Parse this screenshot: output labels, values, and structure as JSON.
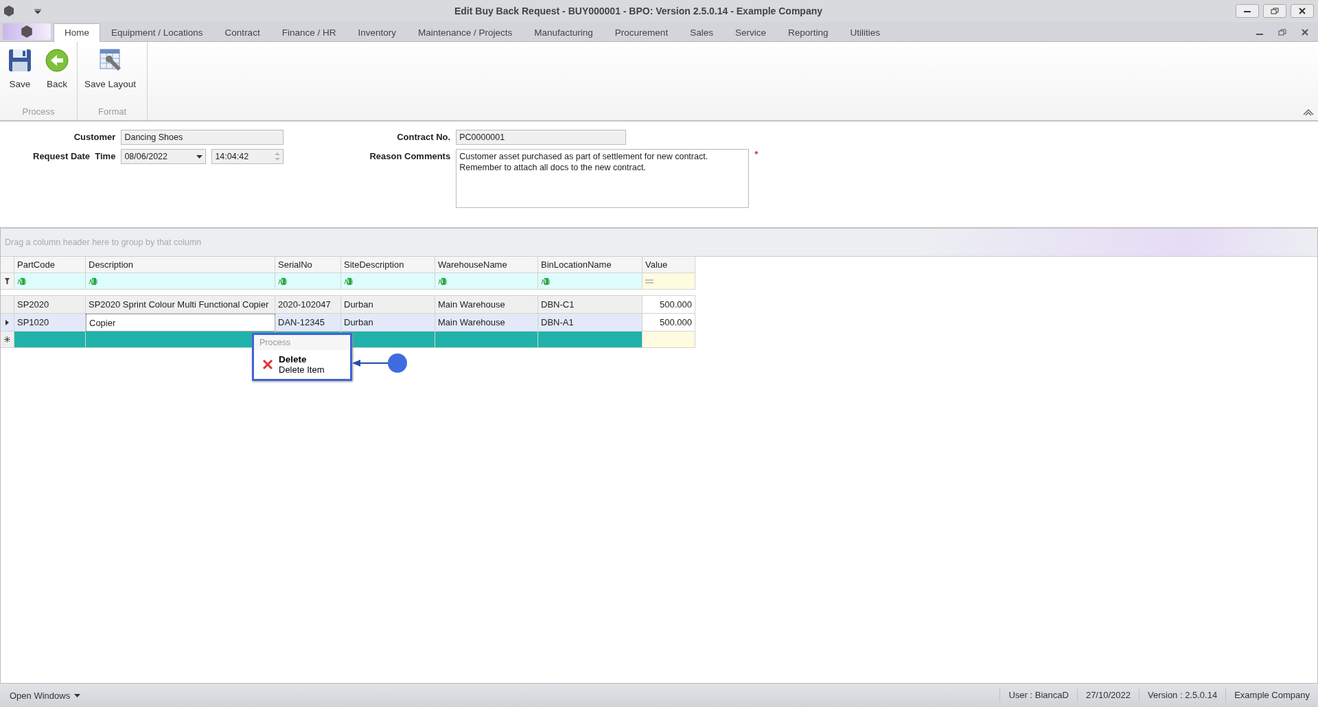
{
  "window": {
    "title": "Edit Buy Back Request - BUY000001 - BPO: Version 2.5.0.14 - Example Company"
  },
  "menu_tabs": [
    {
      "label": "Home",
      "selected": true
    },
    {
      "label": "Equipment / Locations",
      "selected": false
    },
    {
      "label": "Contract",
      "selected": false
    },
    {
      "label": "Finance / HR",
      "selected": false
    },
    {
      "label": "Inventory",
      "selected": false
    },
    {
      "label": "Maintenance / Projects",
      "selected": false
    },
    {
      "label": "Manufacturing",
      "selected": false
    },
    {
      "label": "Procurement",
      "selected": false
    },
    {
      "label": "Sales",
      "selected": false
    },
    {
      "label": "Service",
      "selected": false
    },
    {
      "label": "Reporting",
      "selected": false
    },
    {
      "label": "Utilities",
      "selected": false
    }
  ],
  "ribbon": {
    "groups": [
      {
        "label": "Process",
        "buttons": [
          {
            "label": "Save"
          },
          {
            "label": "Back"
          }
        ]
      },
      {
        "label": "Format",
        "buttons": [
          {
            "label": "Save Layout"
          }
        ]
      }
    ]
  },
  "form": {
    "customer_label": "Customer",
    "customer": "Dancing Shoes",
    "request_label": "Request Date  Time",
    "date": "08/06/2022",
    "time": "14:04:42",
    "contract_label": "Contract No.",
    "contract": "PC0000001",
    "reason_label": "Reason Comments",
    "reason": "Customer asset purchased as part of settlement for new contract.\nRemember to attach all docs to the new contract.",
    "required_mark": "*"
  },
  "grid": {
    "group_hint": "Drag a column header here to group by that column",
    "columns": [
      {
        "label": "PartCode"
      },
      {
        "label": "Description"
      },
      {
        "label": "SerialNo"
      },
      {
        "label": "SiteDescription"
      },
      {
        "label": "WarehouseName"
      },
      {
        "label": "BinLocationName"
      },
      {
        "label": "Value"
      }
    ],
    "rows": [
      {
        "selected": false,
        "cells": [
          "SP2020",
          "SP2020 Sprint Colour Multi Functional Copier",
          "2020-102047",
          "Durban",
          "Main Warehouse",
          "DBN-C1",
          "500.000"
        ]
      },
      {
        "selected": true,
        "cells": [
          "SP1020",
          "Copier",
          "DAN-12345",
          "Durban",
          "Main Warehouse",
          "DBN-A1",
          "500.000"
        ]
      }
    ]
  },
  "context_menu": {
    "header": "Process",
    "items": [
      {
        "title": "Delete",
        "subtitle": "Delete Item"
      }
    ]
  },
  "status_bar": {
    "open_windows": "Open Windows",
    "user": "User : BiancaD",
    "date": "27/10/2022",
    "version": "Version : 2.5.0.14",
    "company": "Example Company"
  }
}
